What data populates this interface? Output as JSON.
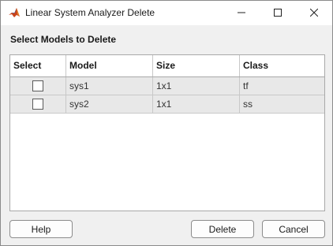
{
  "window": {
    "title": "Linear System Analyzer Delete"
  },
  "section_label": "Select Models to Delete",
  "table": {
    "columns": [
      "Select",
      "Model",
      "Size",
      "Class"
    ],
    "rows": [
      {
        "selected": false,
        "model": "sys1",
        "size": "1x1",
        "class": "tf"
      },
      {
        "selected": false,
        "model": "sys2",
        "size": "1x1",
        "class": "ss"
      }
    ]
  },
  "buttons": {
    "help": "Help",
    "delete": "Delete",
    "cancel": "Cancel"
  },
  "icons": {
    "app": "matlab-logo-icon",
    "minimize": "minimize-icon",
    "maximize": "maximize-icon",
    "close": "close-icon"
  }
}
